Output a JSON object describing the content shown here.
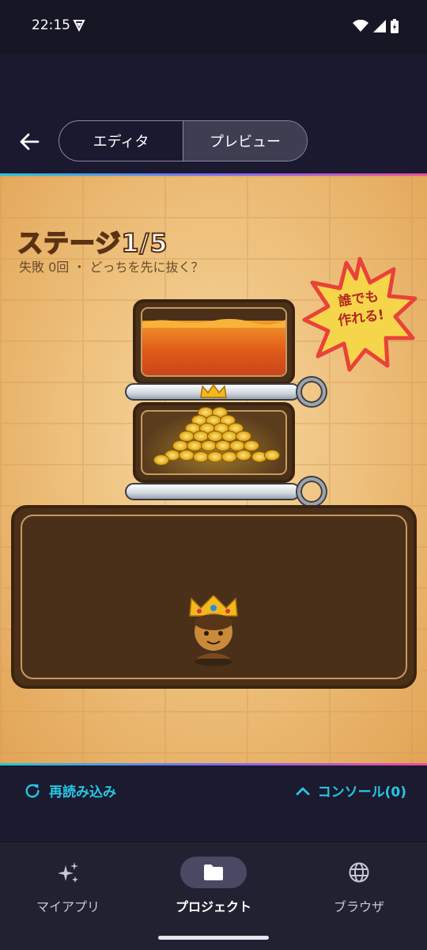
{
  "status": {
    "time": "22:15"
  },
  "header": {
    "tabs": [
      {
        "label": "エディタ",
        "active": false
      },
      {
        "label": "プレビュー",
        "active": true
      }
    ]
  },
  "game": {
    "stage_title": "ステージ1/5",
    "stage_subtitle": "失敗 0回 ・ どっちを先に抜く？",
    "badge_line1": "誰でも",
    "badge_line2": "作れる!"
  },
  "actions": {
    "reload_label": "再読み込み",
    "console_label": "コンソール(0)"
  },
  "nav": {
    "items": [
      {
        "label": "マイアプリ",
        "icon": "sparkle-icon",
        "active": false
      },
      {
        "label": "プロジェクト",
        "icon": "folder-icon",
        "active": true
      },
      {
        "label": "ブラウザ",
        "icon": "globe-icon",
        "active": false
      }
    ]
  },
  "colors": {
    "accent": "#25c8e4",
    "background": "#15141f",
    "badge": "#f5d64a",
    "badge_text": "#b3261e"
  }
}
